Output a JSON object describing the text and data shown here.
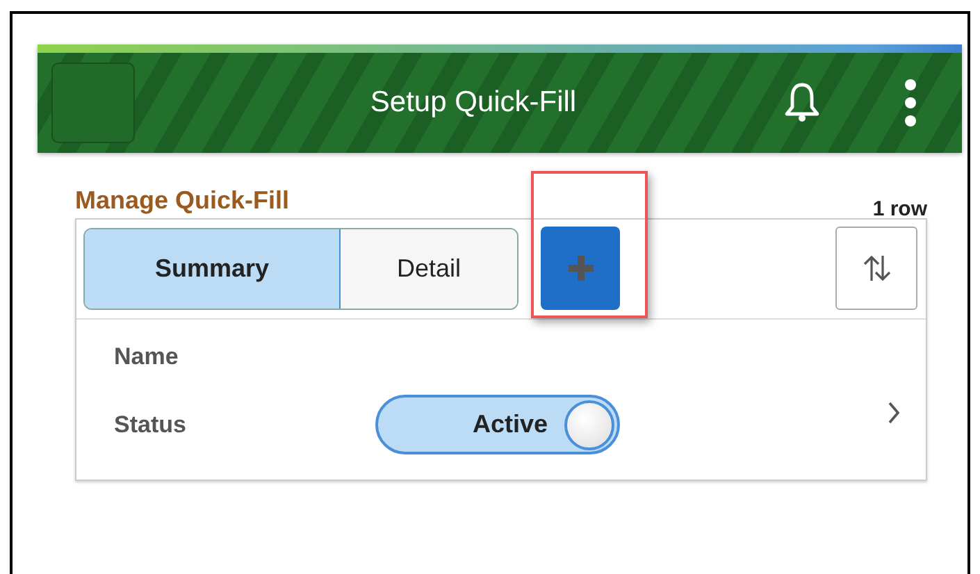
{
  "header": {
    "title": "Setup Quick-Fill"
  },
  "section": {
    "title": "Manage Quick-Fill",
    "row_count": "1 row"
  },
  "tabs": [
    {
      "label": "Summary",
      "selected": true
    },
    {
      "label": "Detail",
      "selected": false
    }
  ],
  "fields": [
    {
      "kind": "text",
      "label": "Name"
    },
    {
      "kind": "toggle",
      "label": "Status",
      "value": "Active",
      "on": true
    }
  ]
}
